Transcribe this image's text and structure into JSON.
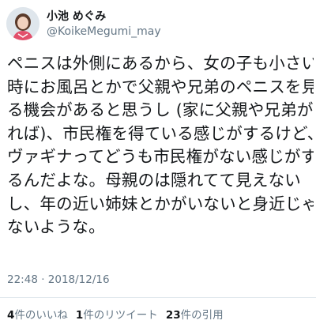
{
  "user": {
    "display_name": "小池 めぐみ",
    "handle": "@KoikeMegumi_may",
    "avatar_icon": "profile-photo-avatar"
  },
  "tweet": {
    "lines": [
      "ペニスは外側にあるから、女の子も小さい",
      "時にお風呂とかで父親や兄弟のペニスを見",
      "る機会があると思うし (家に父親や兄弟がい",
      "れば)、市民権を得ている感じがするけど、",
      "ヴァギナってどうも市民権がない感じがす",
      "るんだよな。母親のは隠れてて見えない",
      "し、年の近い姉妹とかがいないと身近じゃ",
      "ないような。"
    ],
    "timestamp": "22:48 · 2018/12/16"
  },
  "stats": [
    {
      "count": "4",
      "label": "件のいいね"
    },
    {
      "count": "1",
      "label": "件のリツイート"
    },
    {
      "count": "23",
      "label": "件の引用"
    }
  ],
  "colors": {
    "text": "#14171a",
    "secondary": "#657786",
    "divider": "#e1e8ed"
  }
}
